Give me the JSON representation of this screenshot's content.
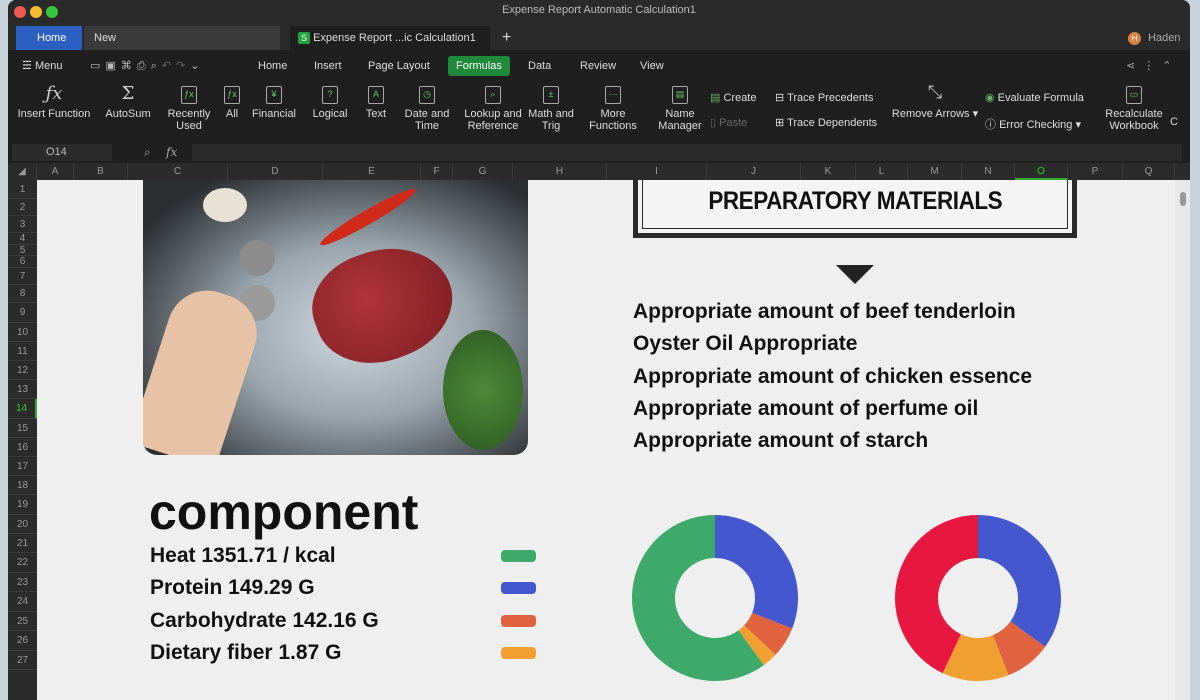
{
  "window": {
    "title": "Expense Report Automatic Calculation1"
  },
  "tabs": [
    {
      "label": "Home",
      "active": true
    },
    {
      "label": "New"
    },
    {
      "label": "Expense Report ...ic Calculation1",
      "document": true
    }
  ],
  "user": {
    "initial": "H",
    "name": "Haden"
  },
  "menu": {
    "label": "Menu",
    "items": [
      "Home",
      "Insert",
      "Page Layout",
      "Formulas",
      "Data",
      "Review",
      "View"
    ],
    "active": "Formulas"
  },
  "ribbon": {
    "buttons": [
      {
        "label": "Insert Function",
        "icon": "fx-icon"
      },
      {
        "label": "AutoSum",
        "icon": "sigma-icon"
      },
      {
        "label": "Recently Used",
        "icon": "recent-function-icon"
      },
      {
        "label": "All",
        "icon": "all-functions-icon"
      },
      {
        "label": "Financial",
        "icon": "financial-icon"
      },
      {
        "label": "Logical",
        "icon": "logical-icon"
      },
      {
        "label": "Text",
        "icon": "text-function-icon"
      },
      {
        "label": "Date and Time",
        "icon": "clock-icon"
      },
      {
        "label": "Lookup and Reference",
        "icon": "lookup-icon"
      },
      {
        "label": "Math and Trig",
        "icon": "math-icon"
      },
      {
        "label": "More Functions",
        "icon": "more-functions-icon"
      },
      {
        "label": "Name Manager",
        "icon": "name-manager-icon"
      }
    ],
    "create": "Create",
    "paste": "Paste",
    "trace_precedents": "Trace Precedents",
    "trace_dependents": "Trace Dependents",
    "remove_arrows": "Remove Arrows",
    "evaluate_formula": "Evaluate Formula",
    "error_checking": "Error Checking",
    "recalculate": "Recalculate Workbook",
    "cut_label": "C"
  },
  "formula_bar": {
    "cell_ref": "O14",
    "fx": "fx",
    "value": ""
  },
  "columns": [
    "A",
    "B",
    "C",
    "D",
    "E",
    "F",
    "G",
    "H",
    "I",
    "J",
    "K",
    "L",
    "M",
    "N",
    "O",
    "P",
    "Q"
  ],
  "selected_column": "O",
  "selected_row": "14",
  "rows": [
    "1",
    "2",
    "3",
    "4",
    "5",
    "6",
    "7",
    "8",
    "9",
    "10",
    "11",
    "12",
    "13",
    "14",
    "15",
    "16",
    "17",
    "18",
    "19",
    "20",
    "21",
    "22",
    "23",
    "24",
    "25",
    "26",
    "27"
  ],
  "content": {
    "prep_title": "PREPARATORY MATERIALS",
    "materials": [
      "Appropriate amount of beef tenderloin",
      "Oyster Oil Appropriate",
      "Appropriate amount of chicken essence",
      "Appropriate amount of perfume oil",
      "Appropriate amount of starch"
    ],
    "component_title": "component",
    "nutrients": [
      {
        "label": "Heat 1351.71 / kcal",
        "color": "#3daa6a"
      },
      {
        "label": "Protein 149.29 G",
        "color": "#4557cf"
      },
      {
        "label": "Carbohydrate 142.16 G",
        "color": "#e0623e"
      },
      {
        "label": "Dietary fiber 1.87 G",
        "color": "#efa030"
      }
    ]
  },
  "chart_data": [
    {
      "type": "pie",
      "donut": true,
      "values": [
        31,
        6,
        3,
        60
      ],
      "colors": [
        "#4557cf",
        "#e0623e",
        "#efa030",
        "#3daa6a"
      ]
    },
    {
      "type": "pie",
      "donut": true,
      "values": [
        35,
        9,
        13,
        43
      ],
      "colors": [
        "#4557cf",
        "#e0623e",
        "#efa030",
        "#e8173f"
      ]
    }
  ]
}
